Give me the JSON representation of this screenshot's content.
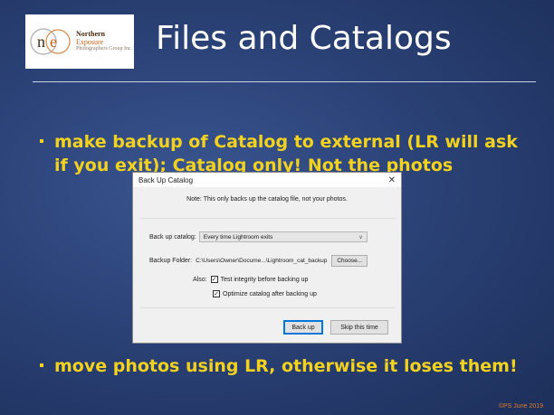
{
  "logo": {
    "brand_word1": "Northern",
    "brand_word2": "Exposure",
    "subtitle": "Photographers Group Inc.",
    "icon": "ne-monogram-logo"
  },
  "slide": {
    "title": "Files and Catalogs",
    "bullets": [
      "make backup of Catalog to external (LR will ask if you exit); Catalog only! Not the photos",
      "move photos using LR, otherwise it loses them!"
    ],
    "copyright": "©PS June 2019"
  },
  "dialog": {
    "title": "Back Up Catalog",
    "close_icon": "close-icon",
    "note": "Note: This only backs up the catalog file, not your photos.",
    "backup_catalog_label": "Back up catalog:",
    "backup_catalog_value": "Every time Lightroom exits",
    "backup_folder_label": "Backup Folder:",
    "backup_folder_path": "C:\\Users\\Owner\\Docume...\\Lightroom_cat_backup",
    "choose_button": "Choose...",
    "also_label": "Also:",
    "options": [
      {
        "label": "Test integrity before backing up",
        "checked": true
      },
      {
        "label": "Optimize catalog after backing up",
        "checked": true
      }
    ],
    "back_up_button": "Back up",
    "skip_button": "Skip this time"
  },
  "colors": {
    "accent_text": "#f2d21e",
    "background": "#2b4277",
    "copyright": "#e27b2c",
    "dialog_primary_border": "#0078d7"
  }
}
